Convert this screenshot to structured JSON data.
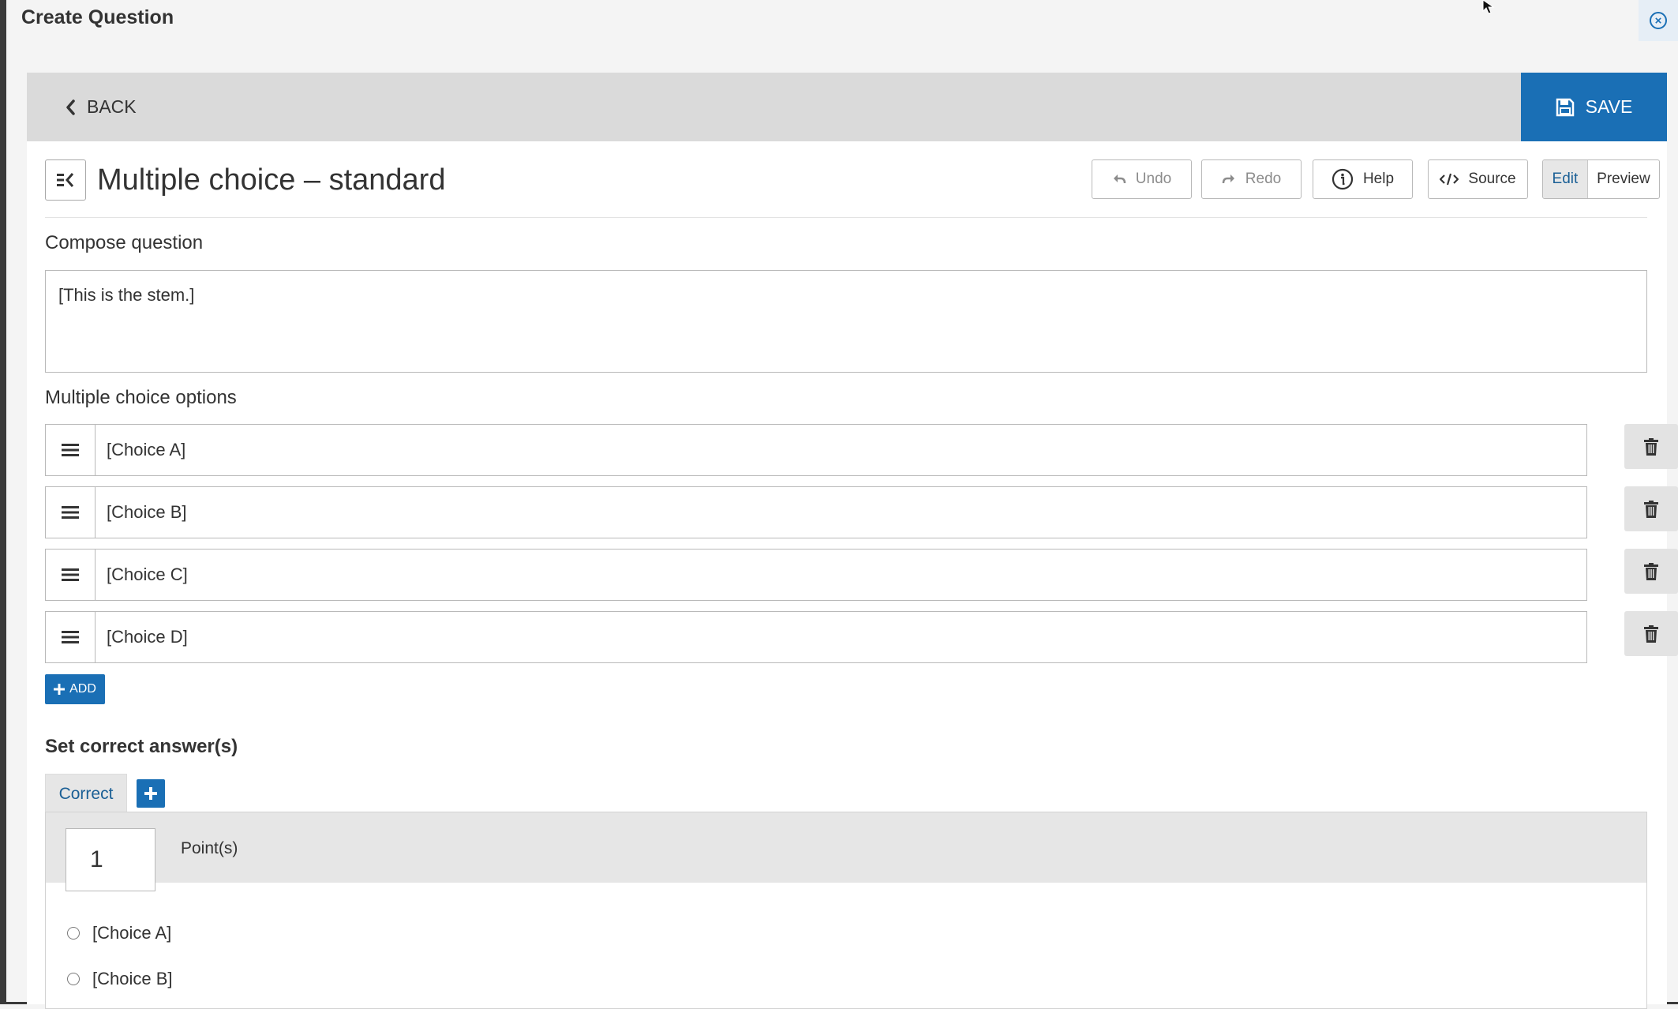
{
  "window": {
    "title": "Create Question"
  },
  "toolbar": {
    "back_label": "BACK",
    "save_label": "SAVE"
  },
  "widget": {
    "title": "Multiple choice – standard"
  },
  "tools": {
    "undo": "Undo",
    "redo": "Redo",
    "help": "Help",
    "source": "Source",
    "edit": "Edit",
    "preview": "Preview"
  },
  "compose": {
    "label": "Compose question",
    "stem": "[This is the stem.]"
  },
  "options": {
    "label": "Multiple choice options",
    "choices": [
      "[Choice A]",
      "[Choice B]",
      "[Choice C]",
      "[Choice D]"
    ],
    "add_label": "ADD"
  },
  "correct": {
    "heading": "Set correct answer(s)",
    "tab_label": "Correct",
    "points_value": "1",
    "points_label": "Point(s)",
    "answers": [
      "[Choice A]",
      "[Choice B]"
    ]
  },
  "colors": {
    "accent": "#1a6fb5",
    "topbar": "#dadada"
  },
  "icons": [
    "close-circle-icon",
    "chevron-left-icon",
    "save-disk-icon",
    "collapse-panel-icon",
    "undo-icon",
    "redo-icon",
    "info-icon",
    "code-icon",
    "drag-handle-icon",
    "trash-icon",
    "plus-icon",
    "radio-icon"
  ]
}
